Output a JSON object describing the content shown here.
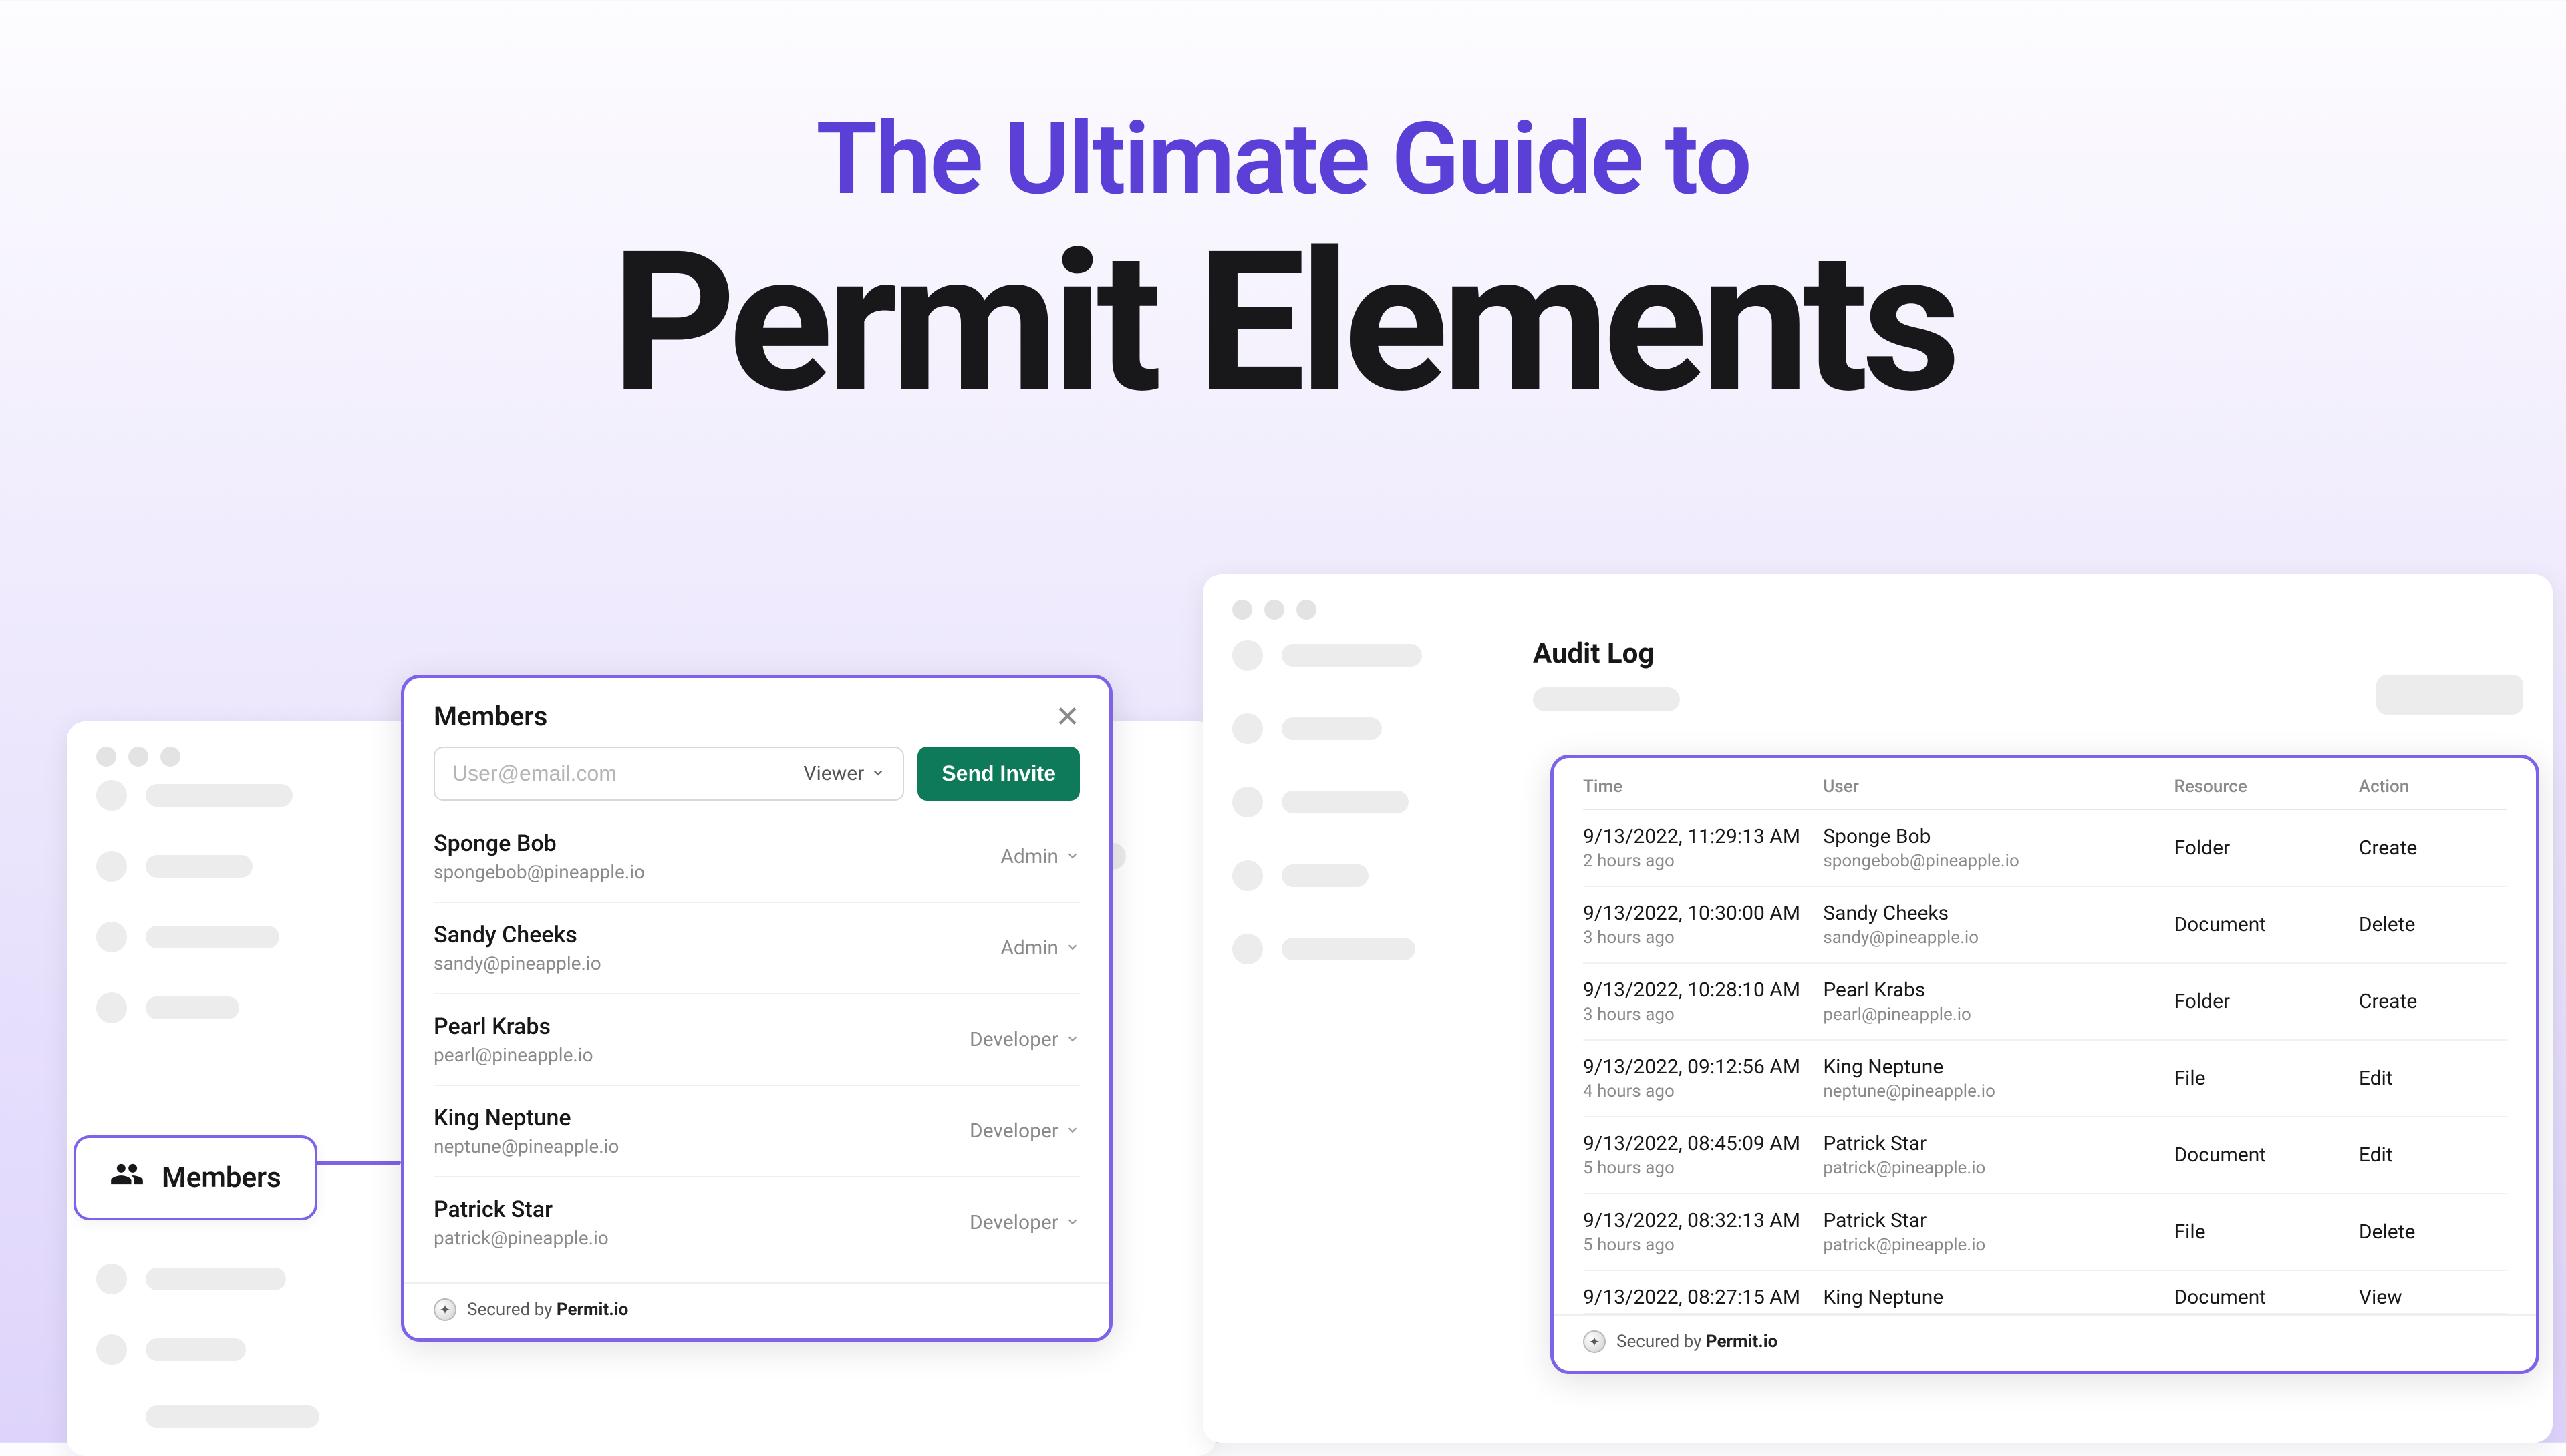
{
  "hero": {
    "subtitle": "The Ultimate Guide to",
    "title": "Permit Elements"
  },
  "colors": {
    "accent": "#5b3fd7",
    "card_border": "#7e62e8",
    "primary_button": "#0f7a5a"
  },
  "nav_pill": {
    "label": "Members"
  },
  "members_card": {
    "title": "Members",
    "invite": {
      "placeholder": "User@email.com",
      "role_selected": "Viewer",
      "button": "Send Invite"
    },
    "members": [
      {
        "name": "Sponge Bob",
        "email": "spongebob@pineapple.io",
        "role": "Admin"
      },
      {
        "name": "Sandy Cheeks",
        "email": "sandy@pineapple.io",
        "role": "Admin"
      },
      {
        "name": "Pearl Krabs",
        "email": "pearl@pineapple.io",
        "role": "Developer"
      },
      {
        "name": "King Neptune",
        "email": "neptune@pineapple.io",
        "role": "Developer"
      },
      {
        "name": "Patrick Star",
        "email": "patrick@pineapple.io",
        "role": "Developer"
      }
    ]
  },
  "audit_panel": {
    "title": "Audit Log"
  },
  "audit_card": {
    "columns": {
      "time": "Time",
      "user": "User",
      "resource": "Resource",
      "action": "Action"
    },
    "rows": [
      {
        "time": "9/13/2022, 11:29:13 AM",
        "ago": "2 hours ago",
        "user_name": "Sponge Bob",
        "user_email": "spongebob@pineapple.io",
        "resource": "Folder",
        "action": "Create"
      },
      {
        "time": "9/13/2022, 10:30:00 AM",
        "ago": "3 hours ago",
        "user_name": "Sandy Cheeks",
        "user_email": "sandy@pineapple.io",
        "resource": "Document",
        "action": "Delete"
      },
      {
        "time": "9/13/2022, 10:28:10 AM",
        "ago": "3 hours ago",
        "user_name": "Pearl Krabs",
        "user_email": "pearl@pineapple.io",
        "resource": "Folder",
        "action": "Create"
      },
      {
        "time": "9/13/2022, 09:12:56 AM",
        "ago": "4 hours ago",
        "user_name": "King Neptune",
        "user_email": "neptune@pineapple.io",
        "resource": "File",
        "action": "Edit"
      },
      {
        "time": "9/13/2022, 08:45:09 AM",
        "ago": "5 hours ago",
        "user_name": "Patrick Star",
        "user_email": "patrick@pineapple.io",
        "resource": "Document",
        "action": "Edit"
      },
      {
        "time": "9/13/2022, 08:32:13 AM",
        "ago": "5 hours ago",
        "user_name": "Patrick Star",
        "user_email": "patrick@pineapple.io",
        "resource": "File",
        "action": "Delete"
      },
      {
        "time": "9/13/2022, 08:27:15 AM",
        "ago": "",
        "user_name": "King Neptune",
        "user_email": "",
        "resource": "Document",
        "action": "View"
      }
    ]
  },
  "secured": {
    "prefix": "Secured by ",
    "brand": "Permit.io"
  }
}
